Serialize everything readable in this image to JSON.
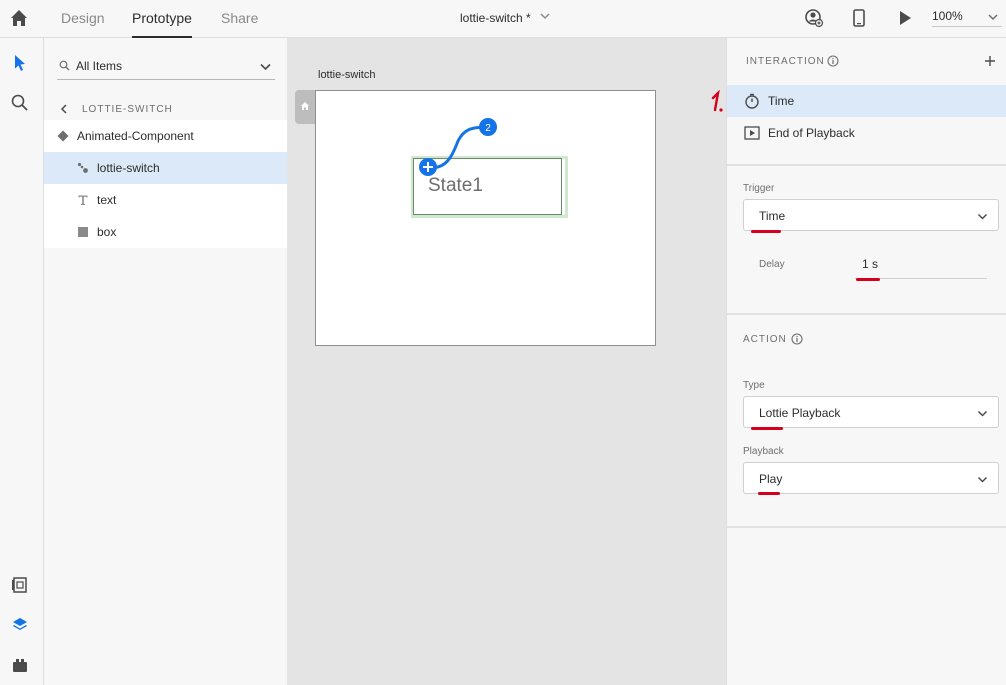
{
  "topbar": {
    "tabs": [
      "Design",
      "Prototype",
      "Share"
    ],
    "active_tab": "Prototype",
    "doc_title": "lottie-switch *",
    "zoom": "100%"
  },
  "layers": {
    "filter": "All Items",
    "breadcrumb": "LOTTIE-SWITCH",
    "items": [
      {
        "name": "Animated-Component",
        "icon": "component-icon"
      },
      {
        "name": "lottie-switch",
        "icon": "lottie-icon",
        "selected": true
      },
      {
        "name": "text",
        "icon": "text-icon"
      },
      {
        "name": "box",
        "icon": "rectangle-icon"
      }
    ]
  },
  "canvas": {
    "artboard_label": "lottie-switch",
    "component_text": "State1",
    "wire_badge": "2"
  },
  "interaction": {
    "title": "INTERACTION",
    "rows": [
      {
        "label": "Time",
        "icon": "stopwatch-icon",
        "selected": true
      },
      {
        "label": "End of Playback",
        "icon": "playback-icon"
      }
    ],
    "annotation": "1.",
    "trigger_label": "Trigger",
    "trigger_value": "Time",
    "delay_label": "Delay",
    "delay_value": "1 s"
  },
  "action": {
    "title": "ACTION",
    "type_label": "Type",
    "type_value": "Lottie Playback",
    "playback_label": "Playback",
    "playback_value": "Play"
  },
  "colors": {
    "accent": "#1473e6",
    "selected_row": "#dbe9f8",
    "annotation_red": "#d6001c"
  }
}
